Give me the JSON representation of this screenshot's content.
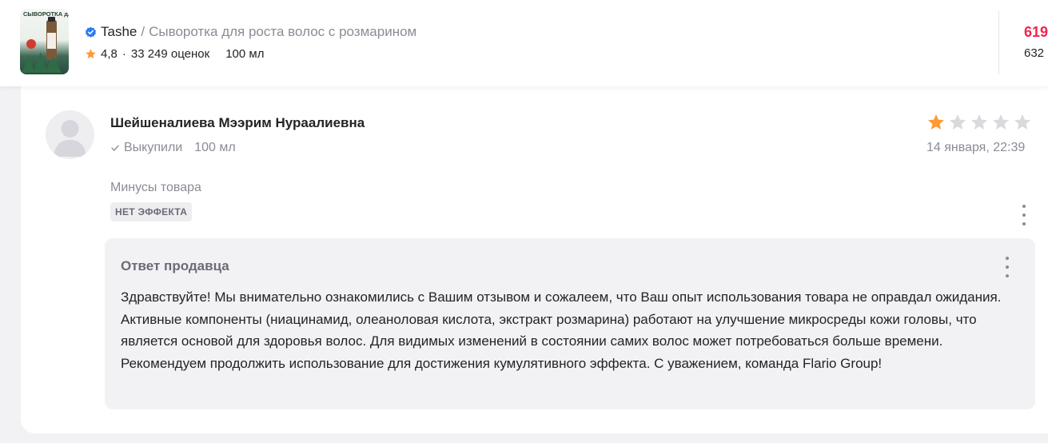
{
  "product": {
    "brand": "Tashe",
    "separator": "/",
    "title": "Сыворотка для роста волос с розмарином",
    "rating": "4,8",
    "rating_separator": "·",
    "ratings_count": "33 249 оценок",
    "volume": "100 мл",
    "price_current": "619",
    "price_old": "632",
    "thumbnail_text": "СЫВОРОТКА для роста волос"
  },
  "review": {
    "author": "Шейшеналиева Мээрим Нураалиевна",
    "purchased_label": "Выкупили",
    "purchased_volume": "100 мл",
    "rating": 1,
    "max_rating": 5,
    "date": "14 января, 22:39",
    "cons_label": "Минусы товара",
    "cons_tag": "НЕТ ЭФФЕКТА"
  },
  "seller_reply": {
    "title": "Ответ продавца",
    "text": "Здравствуйте! Мы внимательно ознакомились с Вашим отзывом и сожалеем, что Ваш опыт использования товара не оправдал ожидания. Активные компоненты (ниацинамид, олеаноловая кислота, экстракт розмарина) работают на улучшение микросреды кожи головы, что является основой для здоровья волос. Для видимых изменений в состоянии самих волос может потребоваться больше времени. Рекомендуем продолжить использование для достижения кумулятивного эффекта. С уважением, команда Flario Group!"
  },
  "colors": {
    "star_filled": "#ff9a35",
    "star_empty": "#d9d9de",
    "price": "#f5224d",
    "verified": "#2b7bf0",
    "muted_text": "#8b8b96"
  },
  "icons": {
    "verified": "verified-badge-icon",
    "rating_star": "star-icon",
    "purchased": "check-icon",
    "menu": "more-vertical-icon",
    "avatar": "user-placeholder-icon"
  }
}
